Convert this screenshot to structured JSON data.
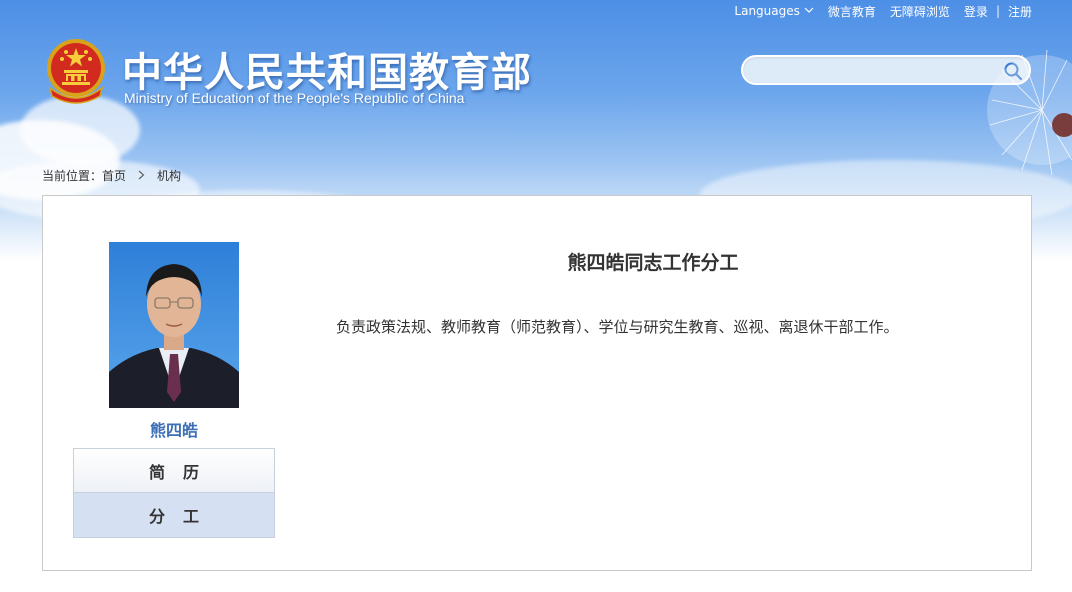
{
  "topbar": {
    "languages": "Languages",
    "weibo": "微言教育",
    "accessibility": "无障碍浏览",
    "login": "登录",
    "separator": "|",
    "register": "注册"
  },
  "header": {
    "title_cn": "中华人民共和国教育部",
    "title_en": "Ministry of Education of the People's Republic of China"
  },
  "search": {
    "value": "",
    "placeholder": ""
  },
  "breadcrumb": {
    "prefix": "当前位置：",
    "home": "首页",
    "current": "机构"
  },
  "profile": {
    "name": "熊四皓",
    "tabs": [
      {
        "label": "简历"
      },
      {
        "label": "分工"
      }
    ],
    "active_tab": "分工"
  },
  "duty": {
    "title": "熊四皓同志工作分工",
    "text": "负责政策法规、教师教育（师范教育）、学位与研究生教育、巡视、离退休干部工作。"
  },
  "colors": {
    "sky_top": "#4d8fe6",
    "name_link": "#3d6fb6",
    "active_tab_bg": "#d6e0f3",
    "panel_border": "#c9c9c9"
  },
  "icons": {
    "emblem": "national-emblem-icon",
    "search": "search-icon",
    "chevron": "chevron-down-icon",
    "breadcrumb_sep": "chevron-right-icon"
  }
}
